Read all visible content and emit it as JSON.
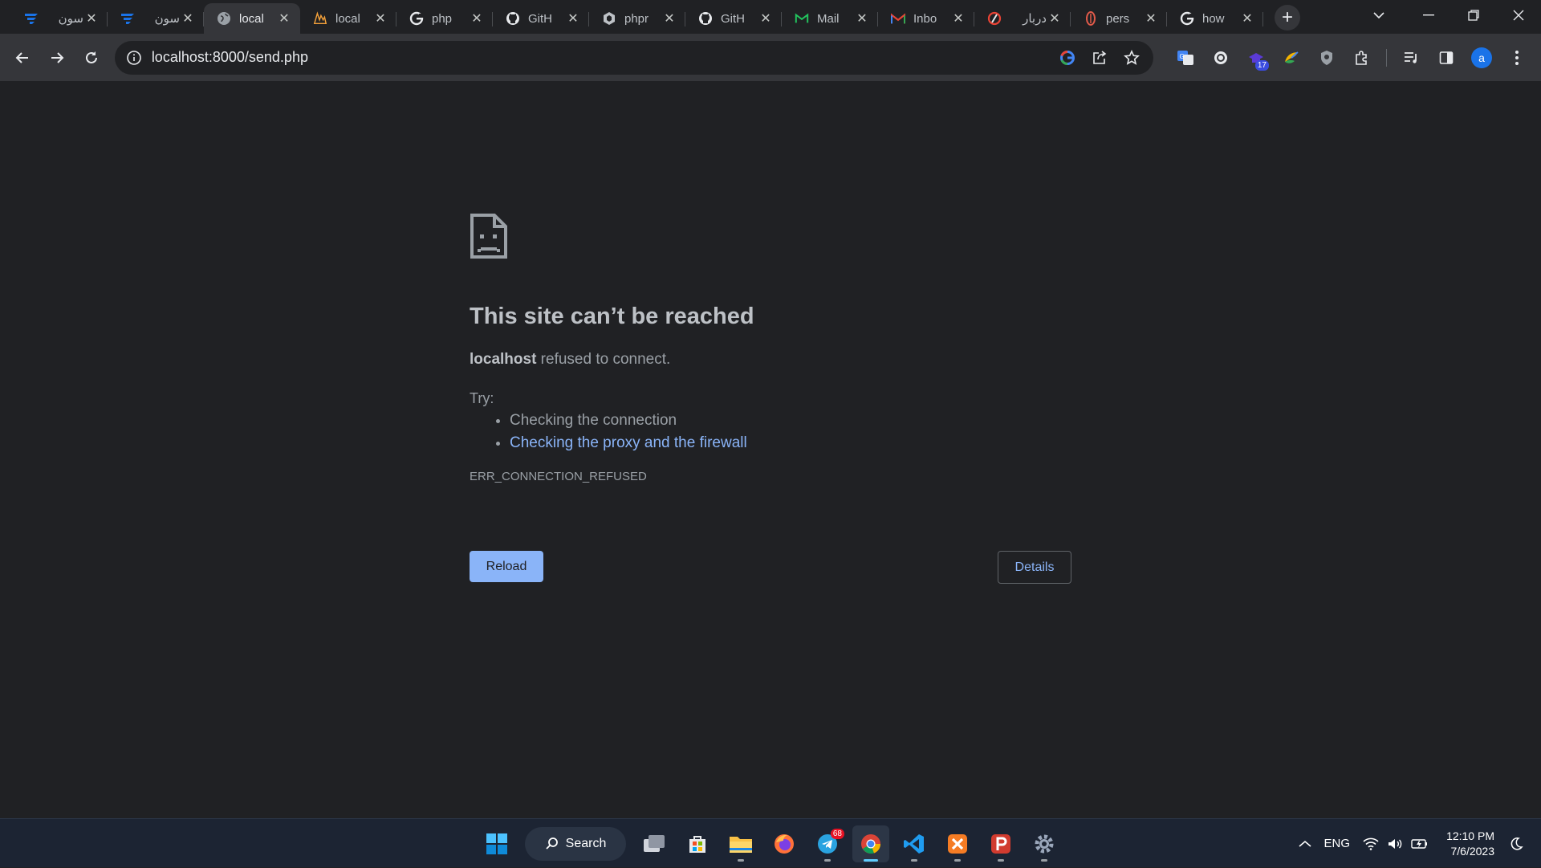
{
  "tabs": [
    {
      "title": "سون",
      "icon": "sevenlearn-icon",
      "active": false
    },
    {
      "title": "سون",
      "icon": "sevenlearn-icon",
      "active": false
    },
    {
      "title": "local",
      "icon": "globe-icon",
      "active": true
    },
    {
      "title": "local",
      "icon": "laravel-icon",
      "active": false
    },
    {
      "title": "php",
      "icon": "google-icon",
      "active": false
    },
    {
      "title": "GitH",
      "icon": "github-icon",
      "active": false
    },
    {
      "title": "phpr",
      "icon": "phpmyadmin-icon",
      "active": false
    },
    {
      "title": "GitH",
      "icon": "github-icon",
      "active": false
    },
    {
      "title": "Mail",
      "icon": "mailtrap-icon",
      "active": false
    },
    {
      "title": "Inbo",
      "icon": "gmail-icon",
      "active": false
    },
    {
      "title": "دربار",
      "icon": "darbar-icon",
      "active": false
    },
    {
      "title": "pers",
      "icon": "persian-logo-icon",
      "active": false
    },
    {
      "title": "how",
      "icon": "google-icon",
      "active": false
    }
  ],
  "address_bar": {
    "url": "localhost:8000/send.php"
  },
  "extensions": {
    "badge_count": "17",
    "profile_initial": "a"
  },
  "error_page": {
    "title": "This site can’t be reached",
    "summary_host": "localhost",
    "summary_text": " refused to connect.",
    "try_label": "Try:",
    "suggestions": [
      "Checking the connection",
      "Checking the proxy and the firewall"
    ],
    "error_code": "ERR_CONNECTION_REFUSED",
    "reload_label": "Reload",
    "details_label": "Details"
  },
  "taskbar": {
    "search_label": "Search",
    "telegram_badge": "68",
    "language": "ENG",
    "time": "12:10 PM",
    "date": "7/6/2023"
  },
  "colors": {
    "page_bg": "#202124",
    "toolbar_bg": "#35363a",
    "link": "#8ab4f8",
    "taskbar_bg": "#1c2433"
  }
}
